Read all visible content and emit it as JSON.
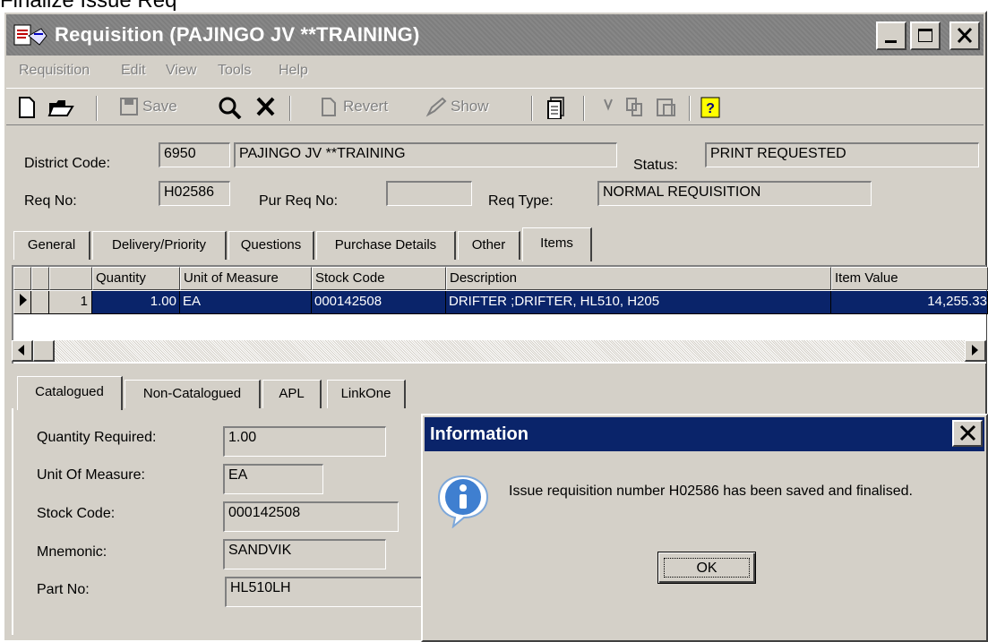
{
  "caption": "Finalize Issue Req",
  "window": {
    "title": "Requisition (PAJINGO JV **TRAINING)"
  },
  "menu": [
    "Requisition",
    "Edit",
    "View",
    "Tools",
    "Help"
  ],
  "toolbar": {
    "save": "Save",
    "revert": "Revert",
    "show": "Show"
  },
  "header": {
    "district_label": "District Code:",
    "district_code": "6950",
    "district_name": "PAJINGO JV **TRAINING",
    "status_label": "Status:",
    "status_value": "PRINT REQUESTED",
    "req_no_label": "Req No:",
    "req_no_value": "H02586",
    "pur_req_label": "Pur Req No:",
    "pur_req_value": "",
    "req_type_label": "Req Type:",
    "req_type_value": "NORMAL REQUISITION"
  },
  "tabs": [
    "General",
    "Delivery/Priority",
    "Questions",
    "Purchase Details",
    "Other",
    "Items"
  ],
  "grid": {
    "columns": [
      "Quantity",
      "Unit of Measure",
      "Stock Code",
      "Description",
      "Item Value"
    ],
    "rows": [
      {
        "row_no": "1",
        "quantity": "1.00",
        "uom": "EA",
        "stock_code": "000142508",
        "description": "DRIFTER ;DRIFTER, HL510, H205",
        "item_value": "14,255.33"
      }
    ]
  },
  "subtabs": [
    "Catalogued",
    "Non-Catalogued",
    "APL",
    "LinkOne"
  ],
  "detail": {
    "qty_label": "Quantity Required:",
    "qty_value": "1.00",
    "uom_label": "Unit Of Measure:",
    "uom_value": "EA",
    "stock_label": "Stock Code:",
    "stock_value": "000142508",
    "mnemonic_label": "Mnemonic:",
    "mnemonic_value": "SANDVIK",
    "part_label": "Part No:",
    "part_value": "HL510LH"
  },
  "dialog": {
    "title": "Information",
    "message": "Issue requisition number H02586 has been saved and finalised.",
    "ok_label": "OK"
  },
  "colors": {
    "titlebar_inactive": "#808080",
    "dialog_titlebar": "#0a246a",
    "selection": "#0a246a",
    "face": "#d4d0c8"
  }
}
